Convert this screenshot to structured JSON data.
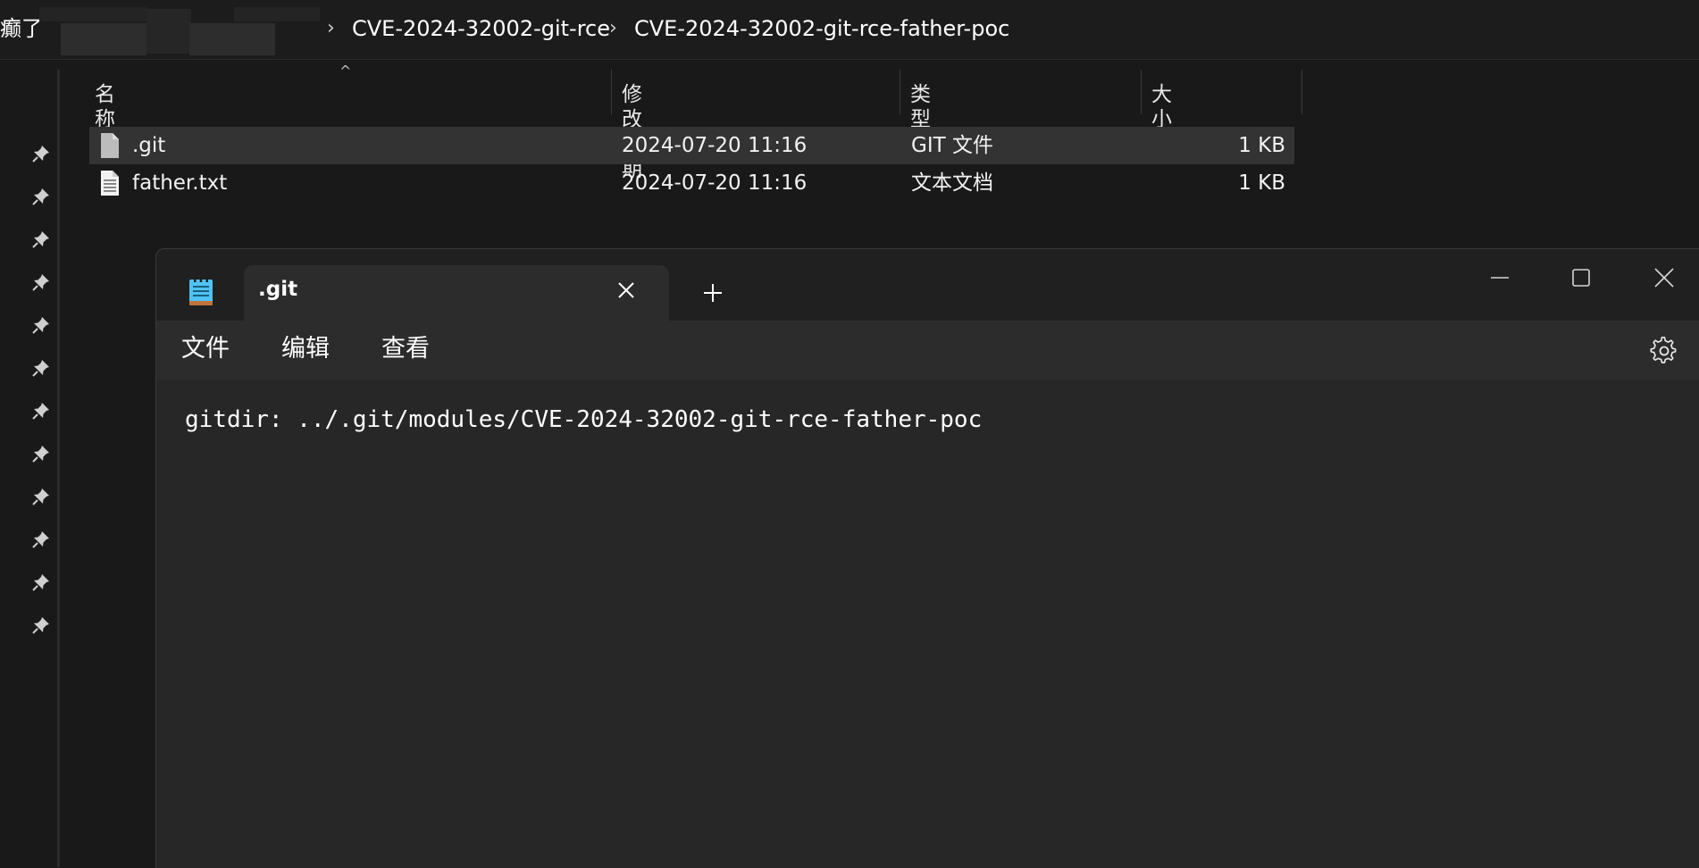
{
  "explorer": {
    "breadcrumb": {
      "partial_label": "癫了",
      "items": [
        "CVE-2024-32002-git-rce",
        "CVE-2024-32002-git-rce-father-poc"
      ]
    },
    "columns": [
      "名称",
      "修改日期",
      "类型",
      "大小"
    ],
    "files": [
      {
        "name": ".git",
        "modified": "2024-07-20 11:16",
        "type": "GIT 文件",
        "size": "1 KB",
        "icon": "blank-file-icon",
        "selected": true
      },
      {
        "name": "father.txt",
        "modified": "2024-07-20 11:16",
        "type": "文本文档",
        "size": "1 KB",
        "icon": "text-file-icon",
        "selected": false
      }
    ],
    "quick_access_pin_count": 12
  },
  "notepad": {
    "tab_title": ".git",
    "menu": [
      "文件",
      "编辑",
      "查看"
    ],
    "content": "gitdir: ../.git/modules/CVE-2024-32002-git-rce-father-poc",
    "icons": {
      "app": "notepad-icon",
      "close_tab": "close-icon",
      "new_tab": "plus-icon",
      "settings": "gear-icon",
      "minimize": "minimize-icon",
      "maximize": "maximize-icon",
      "close_window": "close-icon"
    }
  },
  "colors": {
    "background": "#191919",
    "selected_row": "#333333",
    "notepad_editor": "#272727",
    "notepad_menubar": "#2c2c2c",
    "notepad_icon_accent": "#4fc3f7"
  }
}
